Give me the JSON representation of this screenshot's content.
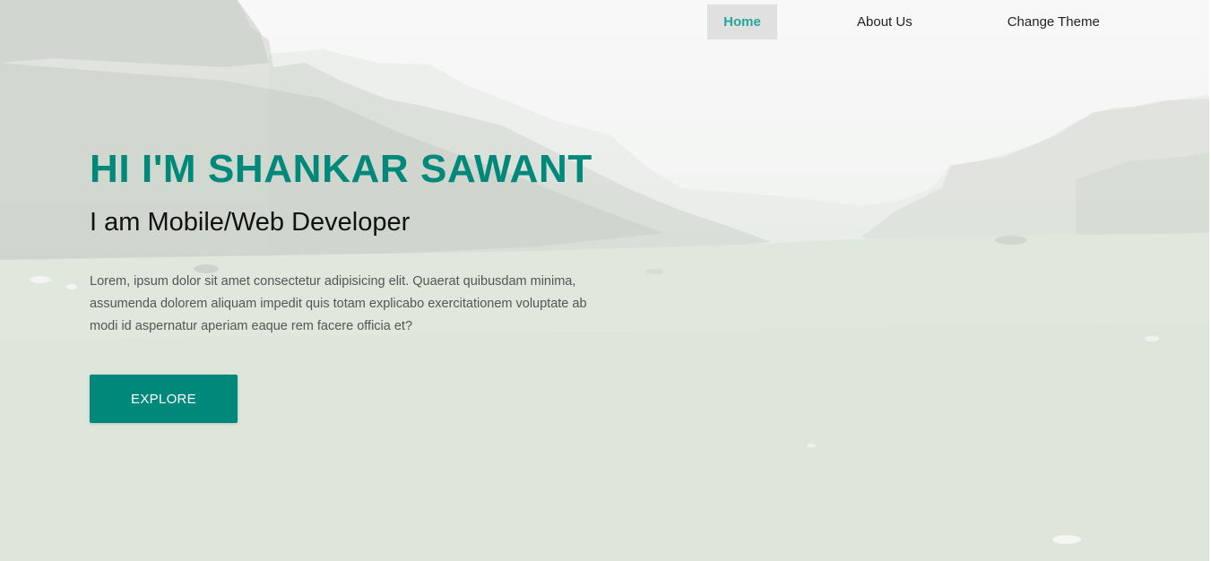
{
  "nav": {
    "items": [
      {
        "label": "Home",
        "active": true
      },
      {
        "label": "About Us",
        "active": false
      },
      {
        "label": "Change Theme",
        "active": false
      }
    ]
  },
  "hero": {
    "title": "HI I'M SHANKAR SAWANT",
    "subtitle": "I am Mobile/Web Developer",
    "description": "Lorem, ipsum dolor sit amet consectetur adipisicing elit. Quaerat quibusdam minima, assumenda dolorem aliquam impedit quis totam explicabo exercitationem voluptate ab modi id aspernatur aperiam eaque rem facere officia et?",
    "button_label": "EXPLORE"
  },
  "colors": {
    "accent": "#00897b",
    "nav_active_text": "#26a69a",
    "nav_active_bg": "#e0e0e0"
  }
}
